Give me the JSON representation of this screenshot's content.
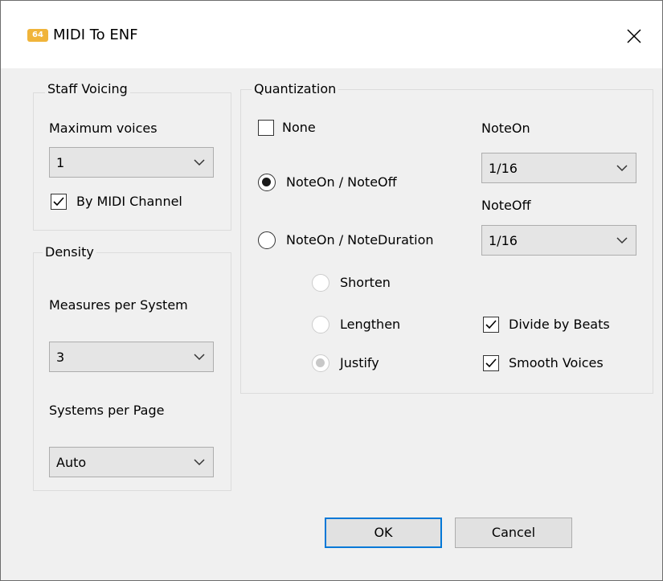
{
  "window": {
    "title": "MIDI To ENF",
    "icon_text": "64"
  },
  "staff_voicing": {
    "group_label": "Staff Voicing",
    "max_voices_label": "Maximum voices",
    "max_voices_value": "1",
    "by_midi_channel_label": "By MIDI Channel",
    "by_midi_channel_checked": true
  },
  "density": {
    "group_label": "Density",
    "measures_label": "Measures per System",
    "measures_value": "3",
    "systems_label": "Systems per Page",
    "systems_value": "Auto"
  },
  "quantization": {
    "group_label": "Quantization",
    "none_label": "None",
    "none_checked": false,
    "noteon_noteoff_label": "NoteOn / NoteOff",
    "noteon_noteduration_label": "NoteOn / NoteDuration",
    "selected_mode": "NoteOn / NoteOff",
    "shorten_label": "Shorten",
    "lengthen_label": "Lengthen",
    "justify_label": "Justify",
    "noteon_label": "NoteOn",
    "noteon_value": "1/16",
    "noteoff_label": "NoteOff",
    "noteoff_value": "1/16",
    "divide_by_beats_label": "Divide by Beats",
    "divide_by_beats_checked": true,
    "smooth_voices_label": "Smooth Voices",
    "smooth_voices_checked": true
  },
  "buttons": {
    "ok_label": "OK",
    "cancel_label": "Cancel"
  },
  "colors": {
    "accent": "#0078d7",
    "dialog_bg": "#f0f0f0"
  }
}
